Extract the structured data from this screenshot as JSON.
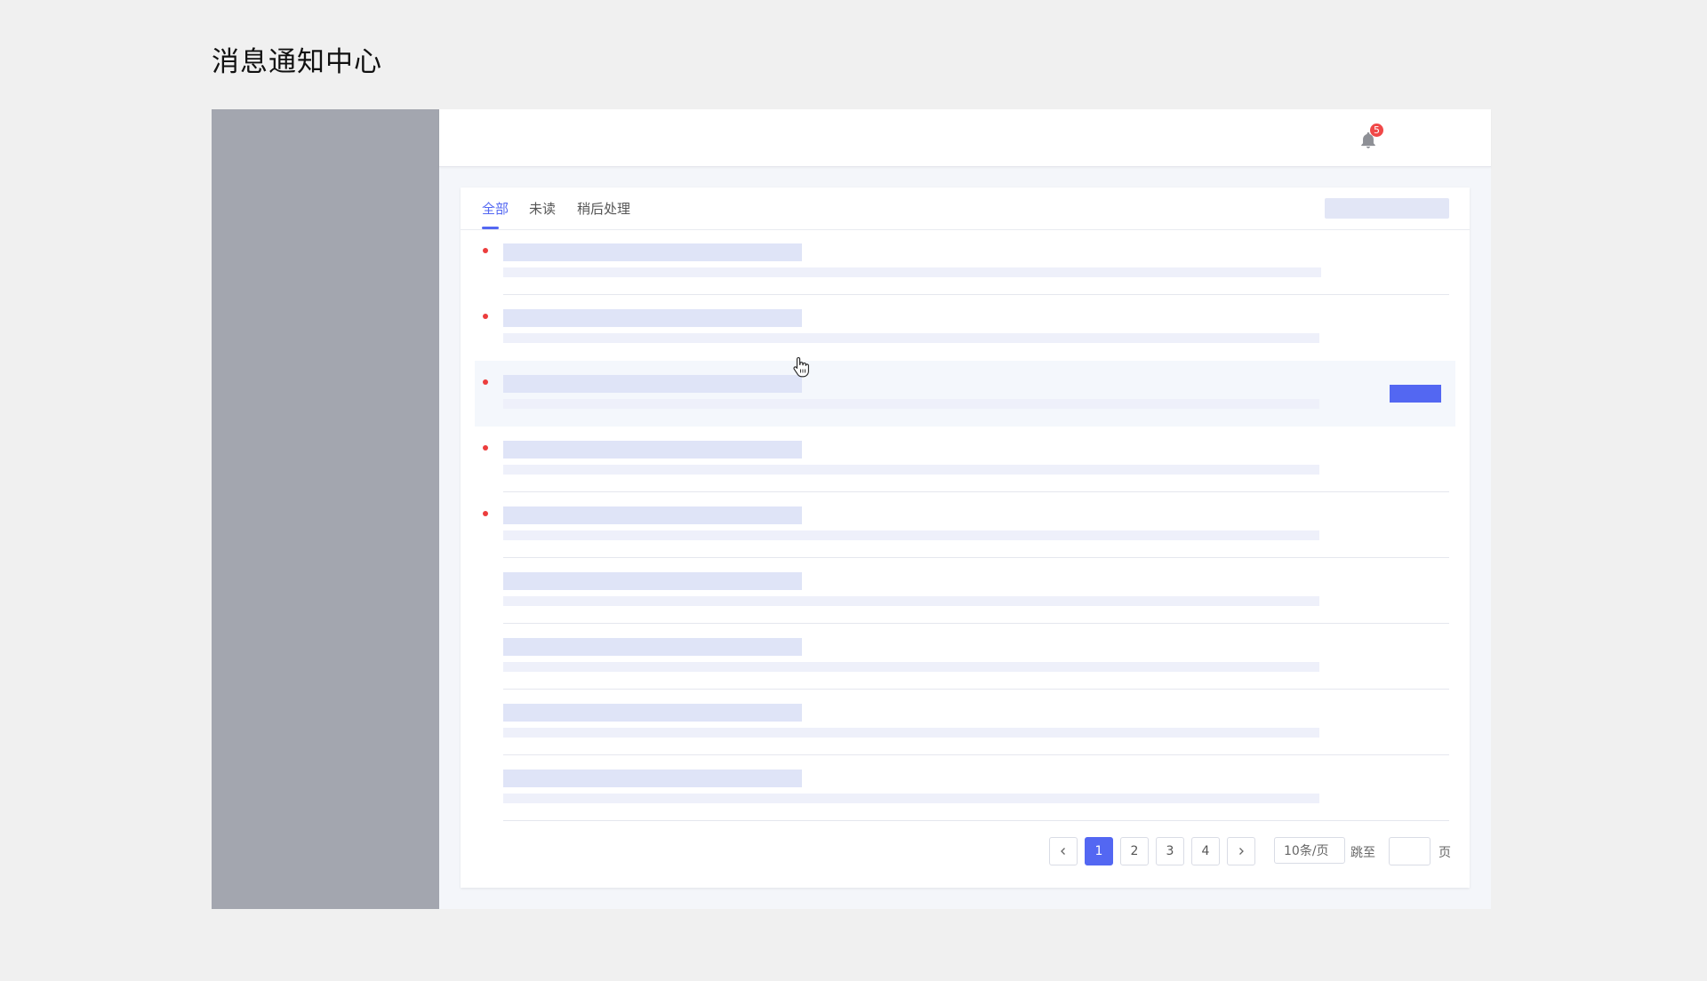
{
  "page": {
    "title": "消息通知中心"
  },
  "topbar": {
    "icon": "bell-icon",
    "badge_count": "5"
  },
  "tabs": [
    {
      "label": "全部",
      "active": true
    },
    {
      "label": "未读",
      "active": false
    },
    {
      "label": "稍后处理",
      "active": false
    }
  ],
  "messages": [
    {
      "unread": true,
      "hovered": false
    },
    {
      "unread": true,
      "hovered": false
    },
    {
      "unread": true,
      "hovered": true
    },
    {
      "unread": true,
      "hovered": false
    },
    {
      "unread": true,
      "hovered": false
    },
    {
      "unread": false,
      "hovered": false
    },
    {
      "unread": false,
      "hovered": false
    },
    {
      "unread": false,
      "hovered": false
    },
    {
      "unread": false,
      "hovered": false
    }
  ],
  "pagination": {
    "prev_icon": "chevron-left-icon",
    "next_icon": "chevron-right-icon",
    "pages": [
      "1",
      "2",
      "3",
      "4"
    ],
    "current_page": "1",
    "page_size_label": "10条/页",
    "jump_label": "跳至",
    "jump_value": "",
    "page_suffix": "页"
  },
  "colors": {
    "accent": "#5367f2",
    "unread_dot": "#ec3d3d",
    "badge": "#f04848",
    "sidebar": "#a3a6af",
    "skeleton_title": "#dfe4f7",
    "skeleton_desc": "#eef0fa"
  }
}
